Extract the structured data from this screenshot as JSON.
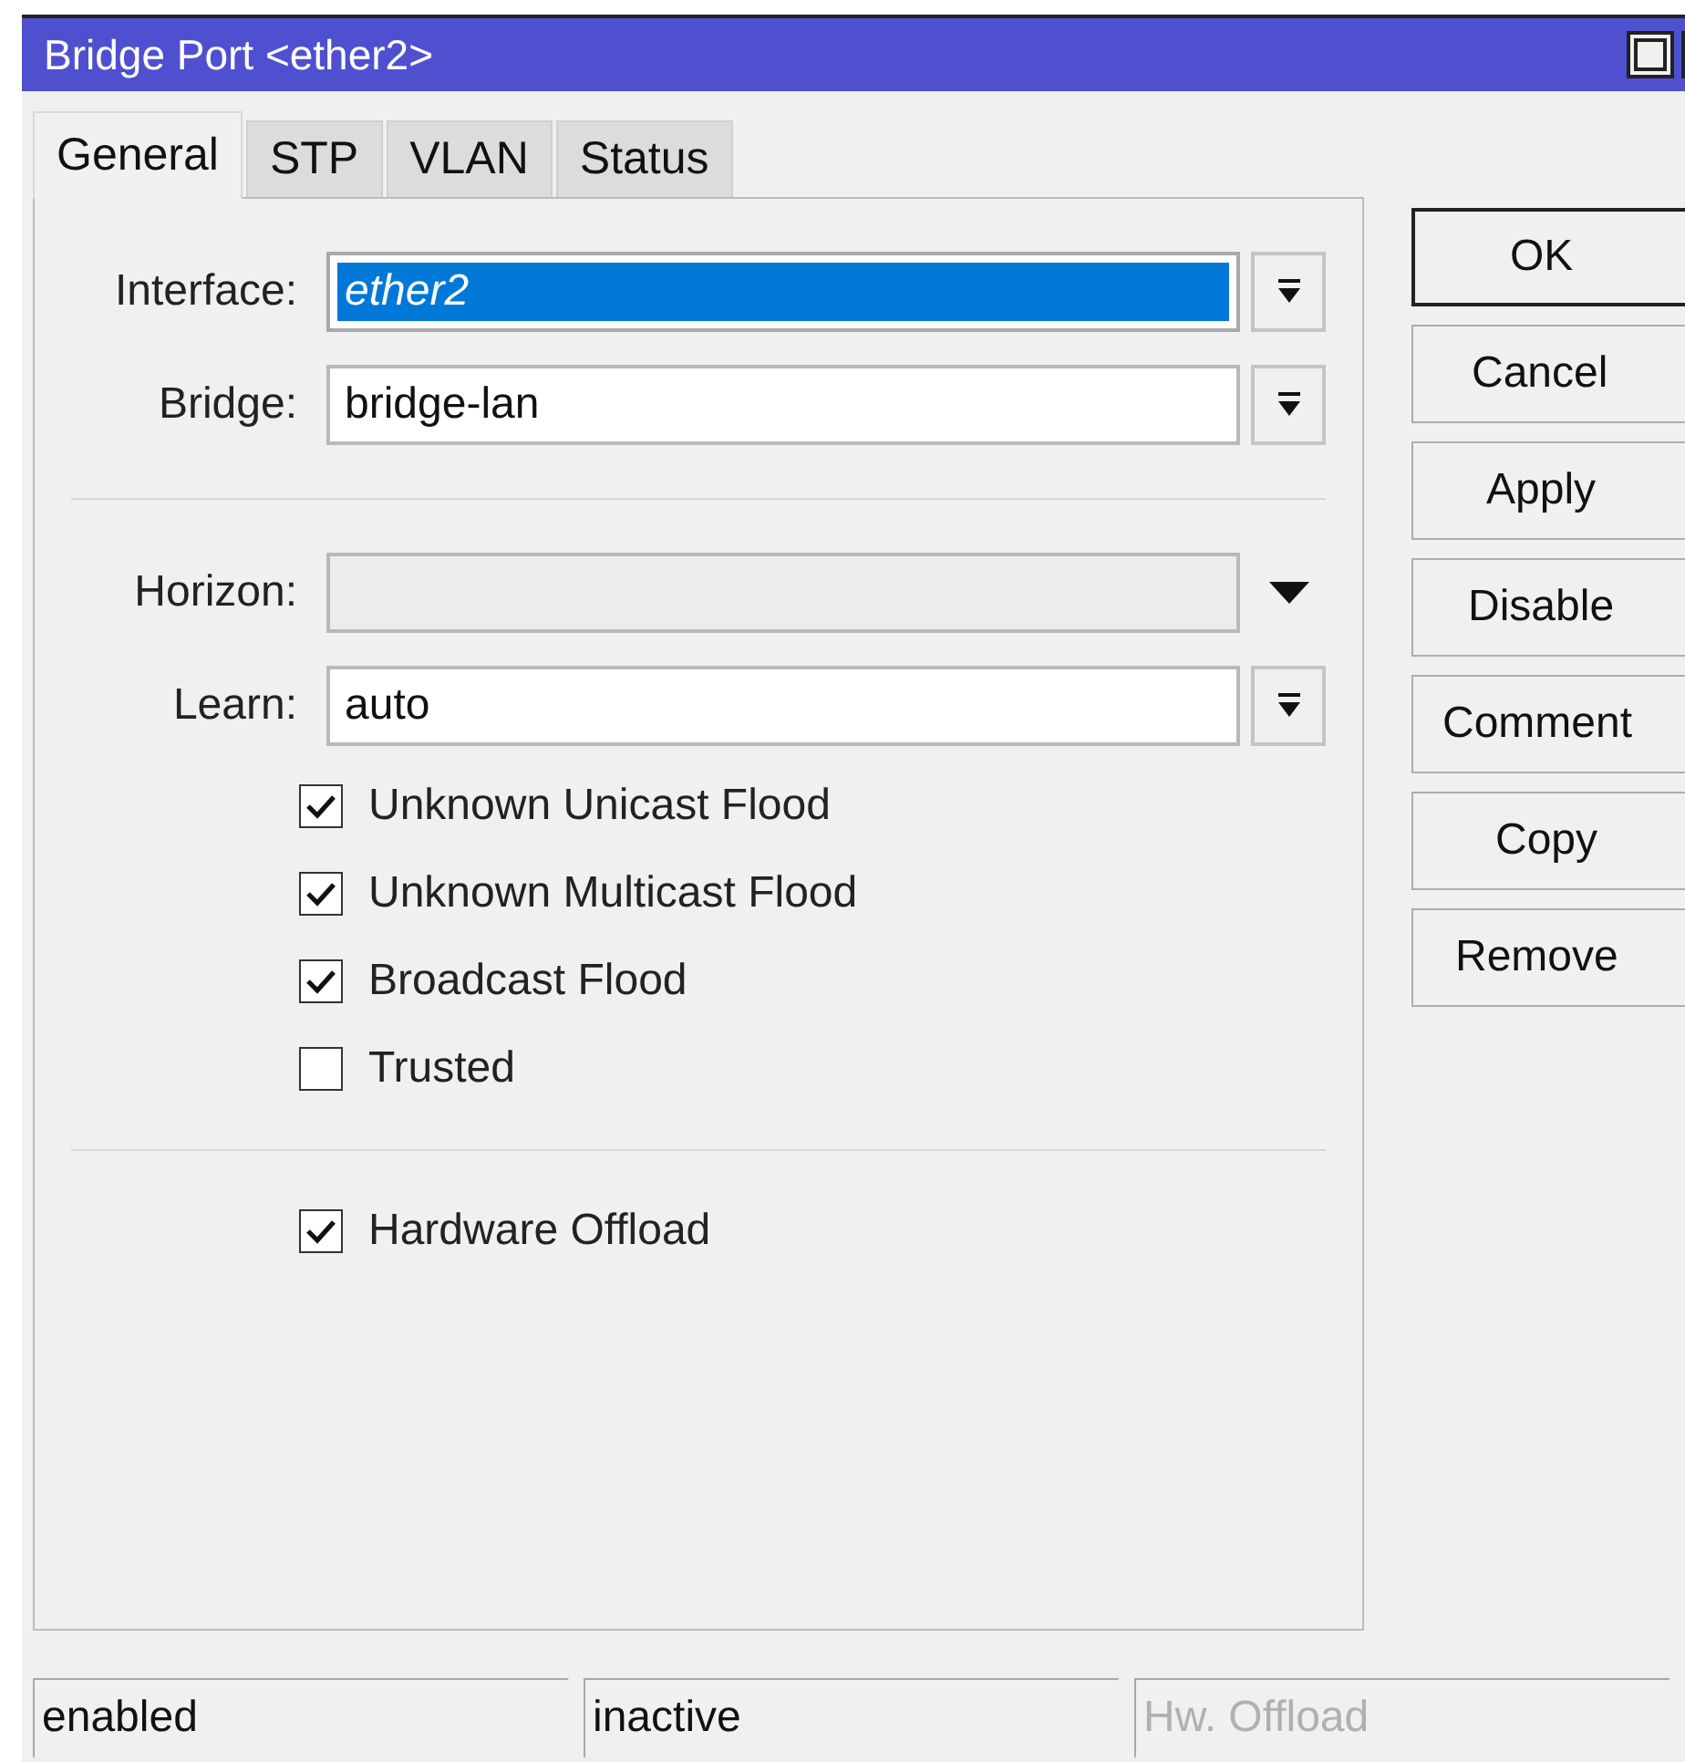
{
  "window": {
    "title": "Bridge Port <ether2>"
  },
  "tabs": [
    {
      "label": "General",
      "selected": true
    },
    {
      "label": "STP",
      "selected": false
    },
    {
      "label": "VLAN",
      "selected": false
    },
    {
      "label": "Status",
      "selected": false
    }
  ],
  "form": [
    {
      "kind": "combo",
      "label": "Interface:",
      "value": "ether2",
      "highlighted": true,
      "disabled": false
    },
    {
      "kind": "combo",
      "label": "Bridge:",
      "value": "bridge-lan",
      "highlighted": false,
      "disabled": false
    },
    {
      "kind": "separator"
    },
    {
      "kind": "dropdown",
      "label": "Horizon:",
      "disabled": true
    },
    {
      "kind": "combo",
      "label": "Learn:",
      "value": "auto",
      "highlighted": false,
      "disabled": false
    },
    {
      "kind": "checkbox",
      "label": "Unknown Unicast Flood",
      "checked": true
    },
    {
      "kind": "checkbox",
      "label": "Unknown Multicast Flood",
      "checked": true
    },
    {
      "kind": "checkbox",
      "label": "Broadcast Flood",
      "checked": true
    },
    {
      "kind": "checkbox",
      "label": "Trusted",
      "checked": false
    },
    {
      "kind": "separator"
    },
    {
      "kind": "checkbox",
      "label": "Hardware Offload",
      "checked": true
    }
  ],
  "buttons": [
    {
      "label": "OK",
      "default": true
    },
    {
      "label": "Cancel",
      "default": false
    },
    {
      "label": "Apply",
      "default": false
    },
    {
      "label": "Disable",
      "default": false
    },
    {
      "label": "Comment",
      "default": false
    },
    {
      "label": "Copy",
      "default": false
    },
    {
      "label": "Remove",
      "default": false
    }
  ],
  "status_bar": [
    {
      "text": "enabled",
      "disabled": false
    },
    {
      "text": "inactive",
      "disabled": false
    },
    {
      "text": "Hw. Offload",
      "disabled": true
    }
  ]
}
